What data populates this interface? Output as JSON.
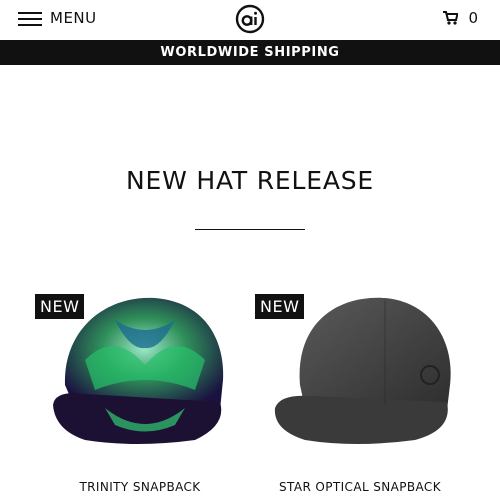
{
  "header": {
    "menu_label": "MENU",
    "cart_count": "0",
    "icons": {
      "menu": "hamburger-icon",
      "logo": "ai-logo",
      "cart": "cart-icon"
    }
  },
  "banner": {
    "text": "WORLDWIDE SHIPPING"
  },
  "section": {
    "title": "NEW HAT RELEASE"
  },
  "products": [
    {
      "badge": "NEW",
      "name": "TRINITY SNAPBACK",
      "image": "psychedelic-green-snapback"
    },
    {
      "badge": "NEW",
      "name": "STAR OPTICAL SNAPBACK",
      "image": "charcoal-snapback"
    }
  ],
  "colors": {
    "text": "#111111",
    "bar_bg": "#111111",
    "bar_text": "#ffffff",
    "badge_bg": "#111111"
  }
}
